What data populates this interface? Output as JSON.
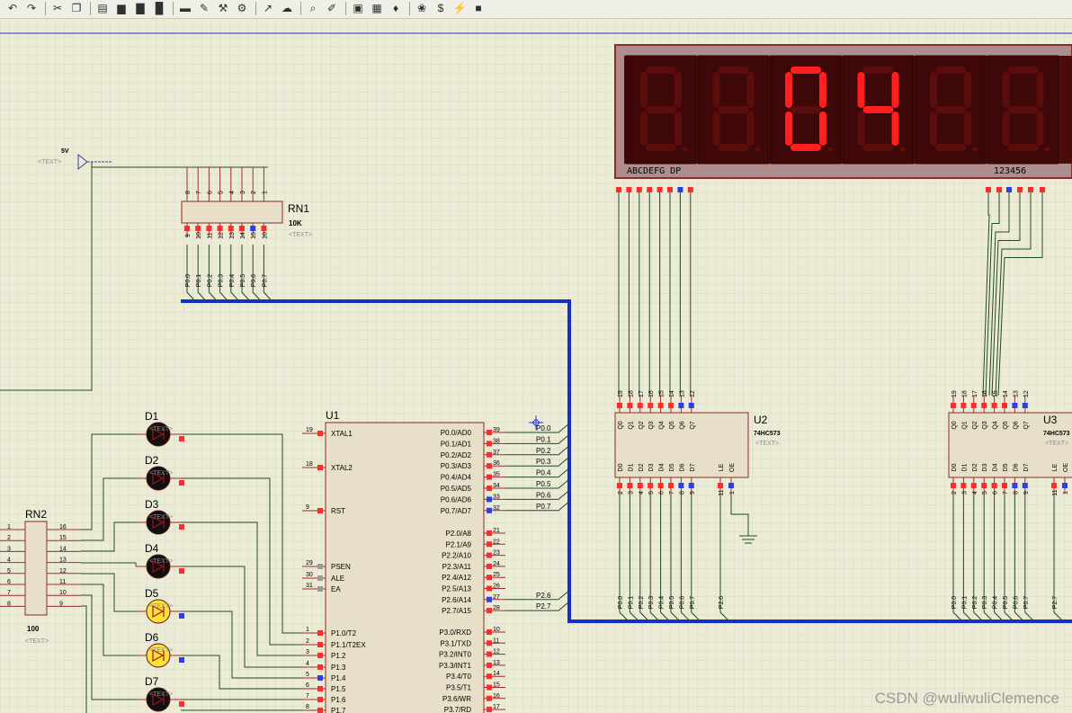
{
  "toolbar": {
    "buttons": [
      {
        "name": "back-icon",
        "glyph": "↶"
      },
      {
        "name": "forward-icon",
        "glyph": "↷"
      },
      {
        "name": "cut-icon",
        "glyph": "✂"
      },
      {
        "name": "copy-icon",
        "glyph": "❐"
      },
      {
        "name": "paste-icon",
        "glyph": "▤"
      },
      {
        "name": "block-copy-icon",
        "glyph": "▆"
      },
      {
        "name": "block-move-icon",
        "glyph": "▇"
      },
      {
        "name": "block-rotate-icon",
        "glyph": "█"
      },
      {
        "name": "block-delete-icon",
        "glyph": "▬"
      },
      {
        "name": "pick-device-icon",
        "glyph": "✎"
      },
      {
        "name": "make-device-icon",
        "glyph": "⚒"
      },
      {
        "name": "package-tool-icon",
        "glyph": "⚙"
      },
      {
        "name": "decompose-icon",
        "glyph": "↗"
      },
      {
        "name": "wire-autorouter-icon",
        "glyph": "☁"
      },
      {
        "name": "search-tag-icon",
        "glyph": "⌕"
      },
      {
        "name": "property-tool-icon",
        "glyph": "✐"
      },
      {
        "name": "bill-of-materials-icon",
        "glyph": "▣"
      },
      {
        "name": "netlist-icon",
        "glyph": "▦"
      },
      {
        "name": "design-explorer-icon",
        "glyph": "♦"
      },
      {
        "name": "new-sheet-icon",
        "glyph": "❀"
      },
      {
        "name": "money-report-icon",
        "glyph": "$"
      },
      {
        "name": "electrical-check-icon",
        "glyph": "⚡"
      },
      {
        "name": "ares-icon",
        "glyph": "■"
      }
    ]
  },
  "colors": {
    "background": "#ecebd6",
    "grid": "#d7d6c2",
    "component": "#e7dfc7",
    "component_border": "#8b2b2b",
    "pin": "#a12c2c",
    "wire": "#1f4d1f",
    "bus": "#1530c8",
    "label": "#000000",
    "text_placeholder": "#8d8d8d",
    "pin_red": "#ff2b2b",
    "pin_blue": "#2a3fe8",
    "seg_on": "#ff1f1f",
    "seg_off": "#5c0c0c",
    "display_body": "#4a0b0b",
    "led_off": "#101010",
    "led_on": "#ffe23a"
  },
  "power": {
    "label": "5V",
    "text": "<TEXT>"
  },
  "rn1": {
    "name": "RN1",
    "value": "10K",
    "text": "<TEXT>",
    "top_pins": [
      "8",
      "7",
      "6",
      "5",
      "4",
      "3",
      "2",
      "1"
    ],
    "bottom_pins": [
      "9",
      "10",
      "11",
      "12",
      "13",
      "14",
      "15",
      "16"
    ],
    "nets": [
      "P0.0",
      "P0.1",
      "P0.2",
      "P0.3",
      "P0.4",
      "P0.5",
      "P0.6",
      "P0.7"
    ]
  },
  "rn2": {
    "name": "RN2",
    "value": "100",
    "text": "<TEXT>",
    "left_pins": [
      "1",
      "2",
      "3",
      "4",
      "5",
      "6",
      "7",
      "8"
    ],
    "right_pins": [
      "16",
      "15",
      "14",
      "13",
      "12",
      "11",
      "10",
      "9"
    ]
  },
  "leds": [
    {
      "name": "D1",
      "on": false
    },
    {
      "name": "D2",
      "on": false
    },
    {
      "name": "D3",
      "on": false
    },
    {
      "name": "D4",
      "on": false
    },
    {
      "name": "D5",
      "on": true
    },
    {
      "name": "D6",
      "on": true
    },
    {
      "name": "D7",
      "on": false
    }
  ],
  "led_text": "<TEXT>",
  "u1": {
    "name": "U1",
    "left_pins": [
      {
        "num": "19",
        "label": "XTAL1"
      },
      {
        "num": "18",
        "label": "XTAL2"
      },
      {
        "num": "9",
        "label": "RST"
      },
      {
        "num": "29",
        "label": "PSEN"
      },
      {
        "num": "30",
        "label": "ALE"
      },
      {
        "num": "31",
        "label": "EA"
      },
      {
        "num": "1",
        "label": "P1.0/T2"
      },
      {
        "num": "2",
        "label": "P1.1/T2EX"
      },
      {
        "num": "3",
        "label": "P1.2"
      },
      {
        "num": "4",
        "label": "P1.3"
      },
      {
        "num": "5",
        "label": "P1.4"
      },
      {
        "num": "6",
        "label": "P1.5"
      },
      {
        "num": "7",
        "label": "P1.6"
      },
      {
        "num": "8",
        "label": "P1.7"
      }
    ],
    "right_pins": [
      {
        "num": "39",
        "label": "P0.0/AD0",
        "net": "P0.0"
      },
      {
        "num": "38",
        "label": "P0.1/AD1",
        "net": "P0.1"
      },
      {
        "num": "37",
        "label": "P0.2/AD2",
        "net": "P0.2"
      },
      {
        "num": "36",
        "label": "P0.3/AD3",
        "net": "P0.3"
      },
      {
        "num": "35",
        "label": "P0.4/AD4",
        "net": "P0.4"
      },
      {
        "num": "34",
        "label": "P0.5/AD5",
        "net": "P0.5"
      },
      {
        "num": "33",
        "label": "P0.6/AD6",
        "net": "P0.6"
      },
      {
        "num": "32",
        "label": "P0.7/AD7",
        "net": "P0.7"
      },
      {
        "num": "21",
        "label": "P2.0/A8",
        "net": ""
      },
      {
        "num": "22",
        "label": "P2.1/A9",
        "net": ""
      },
      {
        "num": "23",
        "label": "P2.2/A10",
        "net": ""
      },
      {
        "num": "24",
        "label": "P2.3/A11",
        "net": ""
      },
      {
        "num": "25",
        "label": "P2.4/A12",
        "net": ""
      },
      {
        "num": "26",
        "label": "P2.5/A13",
        "net": ""
      },
      {
        "num": "27",
        "label": "P2.6/A14",
        "net": "P2.6"
      },
      {
        "num": "28",
        "label": "P2.7/A15",
        "net": "P2.7"
      },
      {
        "num": "10",
        "label": "P3.0/RXD",
        "net": ""
      },
      {
        "num": "11",
        "label": "P3.1/TXD",
        "net": ""
      },
      {
        "num": "12",
        "label": "P3.2/INT0",
        "net": ""
      },
      {
        "num": "13",
        "label": "P3.3/INT1",
        "net": ""
      },
      {
        "num": "14",
        "label": "P3.4/T0",
        "net": ""
      },
      {
        "num": "15",
        "label": "P3.5/T1",
        "net": ""
      },
      {
        "num": "16",
        "label": "P3.6/WR",
        "net": ""
      },
      {
        "num": "17",
        "label": "P3.7/RD",
        "net": ""
      }
    ]
  },
  "u2": {
    "name": "U2",
    "part": "74HC573",
    "text": "<TEXT>",
    "top_pins": [
      "19",
      "18",
      "17",
      "16",
      "15",
      "14",
      "13",
      "12"
    ],
    "out_labels": [
      "Q0",
      "Q1",
      "Q2",
      "Q3",
      "Q4",
      "Q5",
      "Q6",
      "Q7"
    ],
    "in_labels": [
      "D0",
      "D1",
      "D2",
      "D3",
      "D4",
      "D5",
      "D6",
      "D7"
    ],
    "bottom_pins": [
      "2",
      "3",
      "4",
      "5",
      "6",
      "7",
      "8",
      "9"
    ],
    "ctrl_labels": [
      "LE",
      "OE"
    ],
    "ctrl_pins": [
      "11",
      "1"
    ],
    "nets": [
      "P0.0",
      "P0.1",
      "P0.2",
      "P0.3",
      "P0.4",
      "P0.5",
      "P0.6",
      "P0.7",
      "P2.6"
    ]
  },
  "u3": {
    "name": "U3",
    "part": "74HC573",
    "text": "<TEXT>",
    "top_pins": [
      "19",
      "18",
      "17",
      "16",
      "15",
      "14",
      "13",
      "12"
    ],
    "out_labels": [
      "Q0",
      "Q1",
      "Q2",
      "Q3",
      "Q4",
      "Q5",
      "Q6",
      "Q7"
    ],
    "in_labels": [
      "D0",
      "D1",
      "D2",
      "D3",
      "D4",
      "D5",
      "D6",
      "D7"
    ],
    "bottom_pins": [
      "2",
      "3",
      "4",
      "5",
      "6",
      "7",
      "8",
      "9"
    ],
    "ctrl_labels": [
      "LE",
      "OE"
    ],
    "ctrl_pins": [
      "11",
      "1"
    ],
    "nets": [
      "P0.0",
      "P0.1",
      "P0.2",
      "P0.3",
      "P0.4",
      "P0.5",
      "P0.6",
      "P0.7",
      "P2.7"
    ]
  },
  "display": {
    "segment_label": "ABCDEFG DP",
    "digit_label": "123456",
    "digits": [
      "",
      "",
      "0",
      "4",
      "",
      ""
    ]
  },
  "watermark": "CSDN @wuliwuliClemence"
}
